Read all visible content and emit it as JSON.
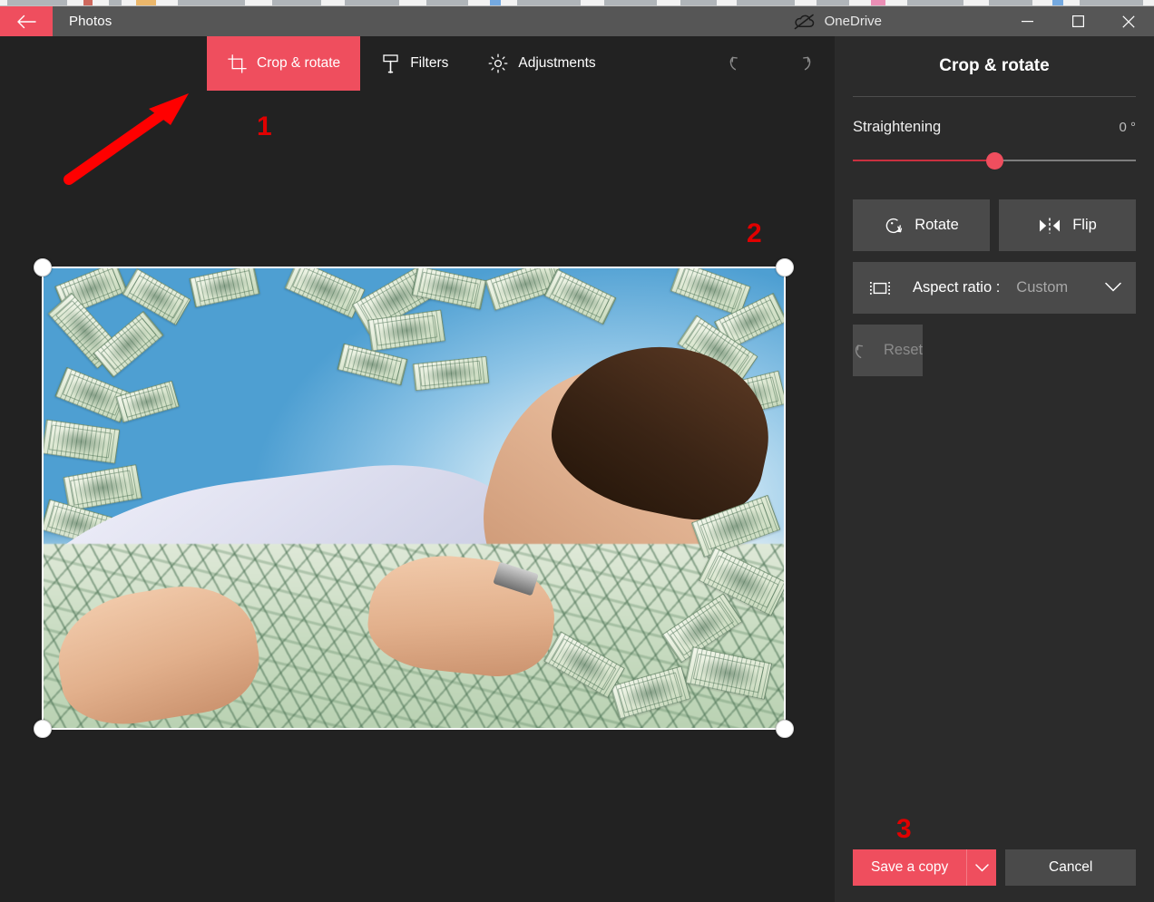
{
  "window": {
    "app_title": "Photos",
    "back_icon": "back-arrow-icon",
    "onedrive_label": "OneDrive",
    "onedrive_icon": "cloud-offline-icon",
    "minimize_label": "Minimize",
    "maximize_label": "Maximize",
    "close_label": "Close"
  },
  "command_bar": {
    "tabs": [
      {
        "label": "Crop & rotate",
        "icon": "crop-icon",
        "active": true
      },
      {
        "label": "Filters",
        "icon": "filters-icon",
        "active": false
      },
      {
        "label": "Adjustments",
        "icon": "brightness-icon",
        "active": false
      }
    ],
    "undo_icon": "undo-icon",
    "redo_icon": "redo-icon"
  },
  "panel": {
    "title": "Crop & rotate",
    "straightening": {
      "label": "Straightening",
      "value": "0 °",
      "slider_percent": 50
    },
    "rotate": {
      "label": "Rotate",
      "icon": "rotate-icon"
    },
    "flip": {
      "label": "Flip",
      "icon": "flip-icon"
    },
    "aspect_ratio": {
      "label": "Aspect ratio :",
      "value": "Custom",
      "icon": "aspect-ratio-icon",
      "chevron": "chevron-down-icon"
    },
    "reset": {
      "label": "Reset",
      "icon": "reset-icon",
      "disabled": true
    }
  },
  "footer": {
    "save_label": "Save a copy",
    "save_caret_icon": "chevron-down-icon",
    "cancel_label": "Cancel"
  },
  "annotations": [
    {
      "label": "1",
      "kind": "step-number"
    },
    {
      "label": "2",
      "kind": "step-number"
    },
    {
      "label": "3",
      "kind": "step-number"
    },
    {
      "label": "",
      "kind": "pointer-arrow",
      "color": "#ff0000"
    }
  ],
  "colors": {
    "accent": "#ef4e5e",
    "titlebar": "#565656",
    "canvas_bg": "#222222",
    "panel_bg": "#2b2b2b",
    "button_bg": "#4a4a4a",
    "annotation_red": "#e00000"
  },
  "photo": {
    "alt": "Man lying face-down on a pile of US hundred dollar bills with money falling from a blue sky",
    "crop_handles": [
      "top-left",
      "top-right",
      "bottom-left",
      "bottom-right"
    ]
  }
}
